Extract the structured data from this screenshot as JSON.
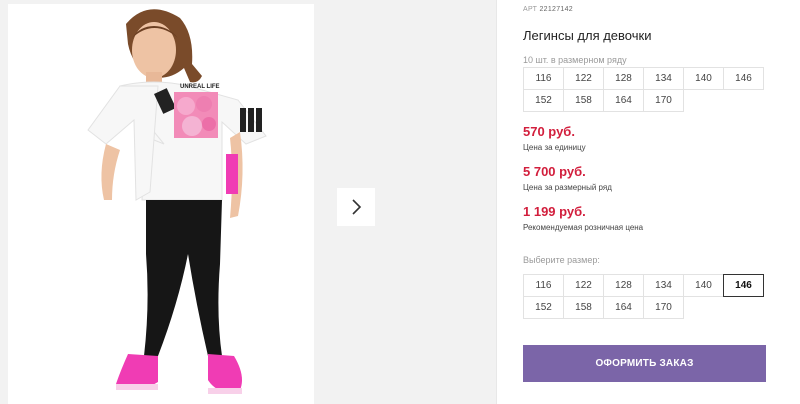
{
  "product": {
    "article_label": "АРТ",
    "article_code": "22127142",
    "title": "Легинсы для девочки",
    "set_label": "10 шт. в размерном ряду",
    "set_sizes": [
      "116",
      "122",
      "128",
      "134",
      "140",
      "146",
      "152",
      "158",
      "164",
      "170"
    ]
  },
  "prices": {
    "unit_price": "570 руб.",
    "unit_price_label": "Цена за единицу",
    "set_price": "5 700 руб.",
    "set_price_label": "Цена за размерный ряд",
    "retail_price": "1 199 руб.",
    "retail_price_label": "Рекомендуемая розничная цена"
  },
  "size_picker": {
    "label": "Выберите размер:",
    "sizes": [
      "116",
      "122",
      "128",
      "134",
      "140",
      "146",
      "152",
      "158",
      "164",
      "170"
    ],
    "selected": "146"
  },
  "order_button": {
    "label": "ОФОРМИТЬ ЗАКАЗ"
  },
  "gallery": {
    "shirt_print_text": "UNREAL LIFE",
    "next_icon": "chevron-right-icon"
  },
  "colors": {
    "price_red": "#d21e3c",
    "button_purple": "#7b65a8",
    "sneaker_pink": "#f03cb4"
  }
}
